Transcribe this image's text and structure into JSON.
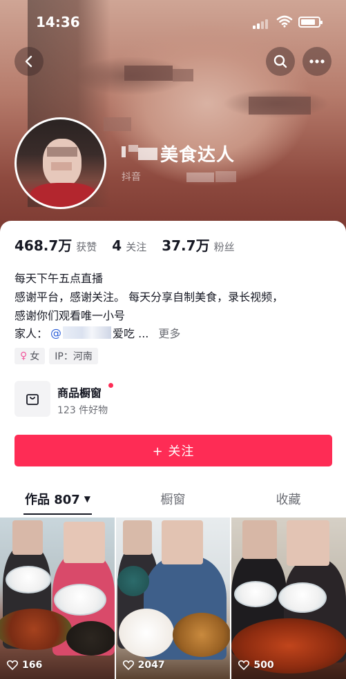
{
  "status_bar": {
    "time": "14:36"
  },
  "profile": {
    "nickname": "美食达人",
    "id_prefix": "抖音"
  },
  "stats": [
    {
      "value": "468.7万",
      "label": "获赞"
    },
    {
      "value": "4",
      "label": "关注"
    },
    {
      "value": "37.7万",
      "label": "粉丝"
    }
  ],
  "bio": {
    "lines": [
      "每天下午五点直播",
      "感谢平台，感谢关注。 每天分享自制美食，录长视频，",
      "感谢你们观看唯一小号"
    ],
    "family_label": "家人：",
    "family_at": "@",
    "family_name_tail": "爱吃 ...",
    "more": "更多"
  },
  "tags": {
    "gender_symbol": "♀",
    "gender": "女",
    "ip": "IP：河南"
  },
  "shop": {
    "title": "商品橱窗",
    "subtitle": "123 件好物"
  },
  "follow_button": "+ 关注",
  "tabs": [
    {
      "label": "作品 807",
      "active": true
    },
    {
      "label": "橱窗",
      "active": false
    },
    {
      "label": "收藏",
      "active": false
    }
  ],
  "videos": [
    {
      "likes": "166"
    },
    {
      "likes": "2047"
    },
    {
      "likes": "500"
    }
  ],
  "colors": {
    "accent": "#fe2c55",
    "text": "#161823",
    "muted": "#6b6d74",
    "link": "#2b5fd9"
  },
  "icons": [
    "back-icon",
    "search-icon",
    "more-icon",
    "shop-bag-icon",
    "heart-icon",
    "caret-down-icon",
    "female-icon"
  ]
}
